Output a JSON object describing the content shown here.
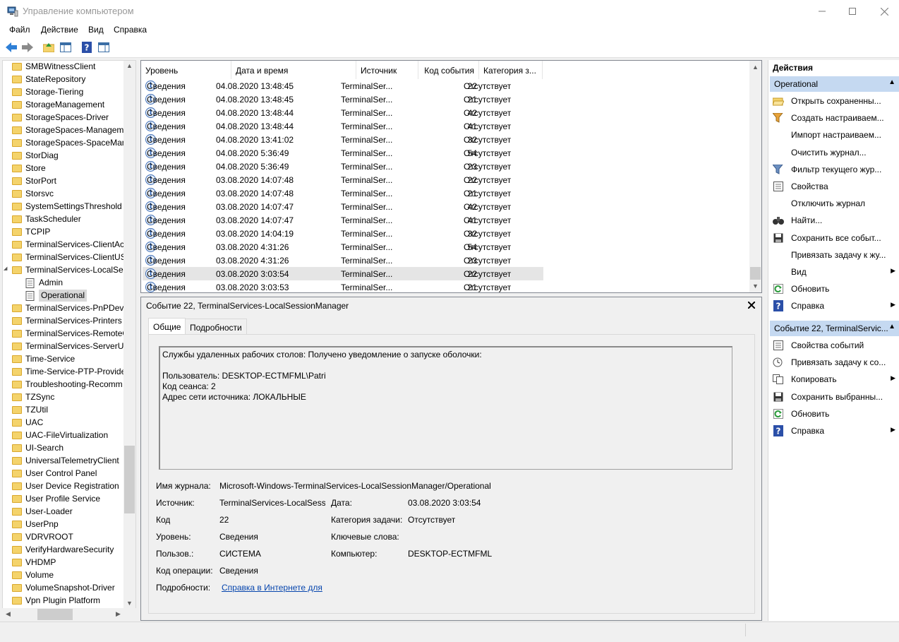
{
  "window": {
    "title": "Управление компьютером"
  },
  "menu": [
    "Файл",
    "Действие",
    "Вид",
    "Справка"
  ],
  "tree": {
    "items": [
      {
        "label": "SMBWitnessClient",
        "type": "folder"
      },
      {
        "label": "StateRepository",
        "type": "folder"
      },
      {
        "label": "Storage-Tiering",
        "type": "folder"
      },
      {
        "label": "StorageManagement",
        "type": "folder"
      },
      {
        "label": "StorageSpaces-Driver",
        "type": "folder"
      },
      {
        "label": "StorageSpaces-Manageme",
        "type": "folder"
      },
      {
        "label": "StorageSpaces-SpaceMana",
        "type": "folder"
      },
      {
        "label": "StorDiag",
        "type": "folder"
      },
      {
        "label": "Store",
        "type": "folder"
      },
      {
        "label": "StorPort",
        "type": "folder"
      },
      {
        "label": "Storsvc",
        "type": "folder"
      },
      {
        "label": "SystemSettingsThreshold",
        "type": "folder"
      },
      {
        "label": "TaskScheduler",
        "type": "folder"
      },
      {
        "label": "TCPIP",
        "type": "folder"
      },
      {
        "label": "TerminalServices-ClientAc",
        "type": "folder"
      },
      {
        "label": "TerminalServices-ClientUS",
        "type": "folder"
      },
      {
        "label": "TerminalServices-LocalSes",
        "type": "folder-open"
      },
      {
        "label": "Admin",
        "type": "log"
      },
      {
        "label": "Operational",
        "type": "log-selected"
      },
      {
        "label": "TerminalServices-PnPDevic",
        "type": "folder"
      },
      {
        "label": "TerminalServices-Printers",
        "type": "folder"
      },
      {
        "label": "TerminalServices-RemoteC",
        "type": "folder"
      },
      {
        "label": "TerminalServices-ServerUS",
        "type": "folder"
      },
      {
        "label": "Time-Service",
        "type": "folder"
      },
      {
        "label": "Time-Service-PTP-Provide",
        "type": "folder"
      },
      {
        "label": "Troubleshooting-Recomm",
        "type": "folder"
      },
      {
        "label": "TZSync",
        "type": "folder"
      },
      {
        "label": "TZUtil",
        "type": "folder"
      },
      {
        "label": "UAC",
        "type": "folder"
      },
      {
        "label": "UAC-FileVirtualization",
        "type": "folder"
      },
      {
        "label": "UI-Search",
        "type": "folder"
      },
      {
        "label": "UniversalTelemetryClient",
        "type": "folder"
      },
      {
        "label": "User Control Panel",
        "type": "folder"
      },
      {
        "label": "User Device Registration",
        "type": "folder"
      },
      {
        "label": "User Profile Service",
        "type": "folder"
      },
      {
        "label": "User-Loader",
        "type": "folder"
      },
      {
        "label": "UserPnp",
        "type": "folder"
      },
      {
        "label": "VDRVROOT",
        "type": "folder"
      },
      {
        "label": "VerifyHardwareSecurity",
        "type": "folder"
      },
      {
        "label": "VHDMP",
        "type": "folder"
      },
      {
        "label": "Volume",
        "type": "folder"
      },
      {
        "label": "VolumeSnapshot-Driver",
        "type": "folder"
      },
      {
        "label": "Vpn Plugin Platform",
        "type": "folder"
      }
    ]
  },
  "events": {
    "columns": [
      "Уровень",
      "Дата и время",
      "Источник",
      "Код события",
      "Категория з..."
    ],
    "rows": [
      [
        "Сведения",
        "04.08.2020 13:48:45",
        "TerminalSer...",
        "22",
        "Отсутствует"
      ],
      [
        "Сведения",
        "04.08.2020 13:48:45",
        "TerminalSer...",
        "21",
        "Отсутствует"
      ],
      [
        "Сведения",
        "04.08.2020 13:48:44",
        "TerminalSer...",
        "42",
        "Отсутствует"
      ],
      [
        "Сведения",
        "04.08.2020 13:48:44",
        "TerminalSer...",
        "41",
        "Отсутствует"
      ],
      [
        "Сведения",
        "04.08.2020 13:41:02",
        "TerminalSer...",
        "32",
        "Отсутствует"
      ],
      [
        "Сведения",
        "04.08.2020 5:36:49",
        "TerminalSer...",
        "54",
        "Отсутствует"
      ],
      [
        "Сведения",
        "04.08.2020 5:36:49",
        "TerminalSer...",
        "23",
        "Отсутствует"
      ],
      [
        "Сведения",
        "03.08.2020 14:07:48",
        "TerminalSer...",
        "22",
        "Отсутствует"
      ],
      [
        "Сведения",
        "03.08.2020 14:07:48",
        "TerminalSer...",
        "21",
        "Отсутствует"
      ],
      [
        "Сведения",
        "03.08.2020 14:07:47",
        "TerminalSer...",
        "42",
        "Отсутствует"
      ],
      [
        "Сведения",
        "03.08.2020 14:07:47",
        "TerminalSer...",
        "41",
        "Отсутствует"
      ],
      [
        "Сведения",
        "03.08.2020 14:04:19",
        "TerminalSer...",
        "32",
        "Отсутствует"
      ],
      [
        "Сведения",
        "03.08.2020 4:31:26",
        "TerminalSer...",
        "54",
        "Отсутствует"
      ],
      [
        "Сведения",
        "03.08.2020 4:31:26",
        "TerminalSer...",
        "23",
        "Отсутствует"
      ],
      [
        "Сведения",
        "03.08.2020 3:03:54",
        "TerminalSer...",
        "22",
        "Отсутствует"
      ],
      [
        "Сведения",
        "03.08.2020 3:03:53",
        "TerminalSer...",
        "21",
        "Отсутствует"
      ]
    ],
    "selected_index": 14
  },
  "detail": {
    "title": "Событие 22, TerminalServices-LocalSessionManager",
    "tabs": [
      "Общие",
      "Подробности"
    ],
    "message_lines": [
      "Службы удаленных рабочих столов: Получено уведомление о запуске оболочки:",
      "",
      "Пользователь: DESKTOP-ECTMFML\\Patri",
      "Код сеанса: 2",
      "Адрес сети источника: ЛОКАЛЬНЫЕ"
    ],
    "fields": {
      "log_name_label": "Имя журнала:",
      "log_name": "Microsoft-Windows-TerminalServices-LocalSessionManager/Operational",
      "source_label": "Источник:",
      "source": "TerminalServices-LocalSessio",
      "date_label": "Дата:",
      "date": "03.08.2020 3:03:54",
      "code_label": "Код",
      "code": "22",
      "task_category_label": "Категория задачи:",
      "task_category": "Отсутствует",
      "level_label": "Уровень:",
      "level": "Сведения",
      "keywords_label": "Ключевые слова:",
      "keywords": "",
      "user_label": "Пользов.:",
      "user": "СИСТЕМА",
      "computer_label": "Компьютер:",
      "computer": "DESKTOP-ECTMFML",
      "opcode_label": "Код операции:",
      "opcode": "Сведения",
      "more_info_label": "Подробности:",
      "more_info_link": "Справка в Интернете для"
    }
  },
  "actions": {
    "header": "Действия",
    "section1": {
      "title": "Operational",
      "items": [
        {
          "label": "Открыть сохраненны...",
          "icon": "folder-open-icon",
          "submenu": false
        },
        {
          "label": "Создать настраиваем...",
          "icon": "filter-create-icon",
          "submenu": false
        },
        {
          "label": "Импорт настраиваем...",
          "icon": "",
          "submenu": false
        },
        {
          "label": "Очистить журнал...",
          "icon": "",
          "submenu": false
        },
        {
          "label": "Фильтр текущего жур...",
          "icon": "filter-icon",
          "submenu": false
        },
        {
          "label": "Свойства",
          "icon": "properties-icon",
          "submenu": false
        },
        {
          "label": "Отключить журнал",
          "icon": "",
          "submenu": false
        },
        {
          "label": "Найти...",
          "icon": "binoculars-icon",
          "submenu": false
        },
        {
          "label": "Сохранить все событ...",
          "icon": "save-icon",
          "submenu": false
        },
        {
          "label": "Привязать задачу к жу...",
          "icon": "",
          "submenu": false
        },
        {
          "label": "Вид",
          "icon": "",
          "submenu": true
        },
        {
          "label": "Обновить",
          "icon": "refresh-icon",
          "submenu": false
        },
        {
          "label": "Справка",
          "icon": "help-icon",
          "submenu": true
        }
      ]
    },
    "section2": {
      "title": "Событие 22, TerminalServic...",
      "items": [
        {
          "label": "Свойства событий",
          "icon": "properties-icon",
          "submenu": false
        },
        {
          "label": "Привязать задачу к со...",
          "icon": "task-icon",
          "submenu": false
        },
        {
          "label": "Копировать",
          "icon": "copy-icon",
          "submenu": true
        },
        {
          "label": "Сохранить выбранны...",
          "icon": "save-icon",
          "submenu": false
        },
        {
          "label": "Обновить",
          "icon": "refresh-icon",
          "submenu": false
        },
        {
          "label": "Справка",
          "icon": "help-icon",
          "submenu": true
        }
      ]
    }
  },
  "colors": {
    "selection": "#c5d9f1",
    "row_selected": "#e5e5e5",
    "link": "#0645ad",
    "folder": "#f4d36b"
  }
}
